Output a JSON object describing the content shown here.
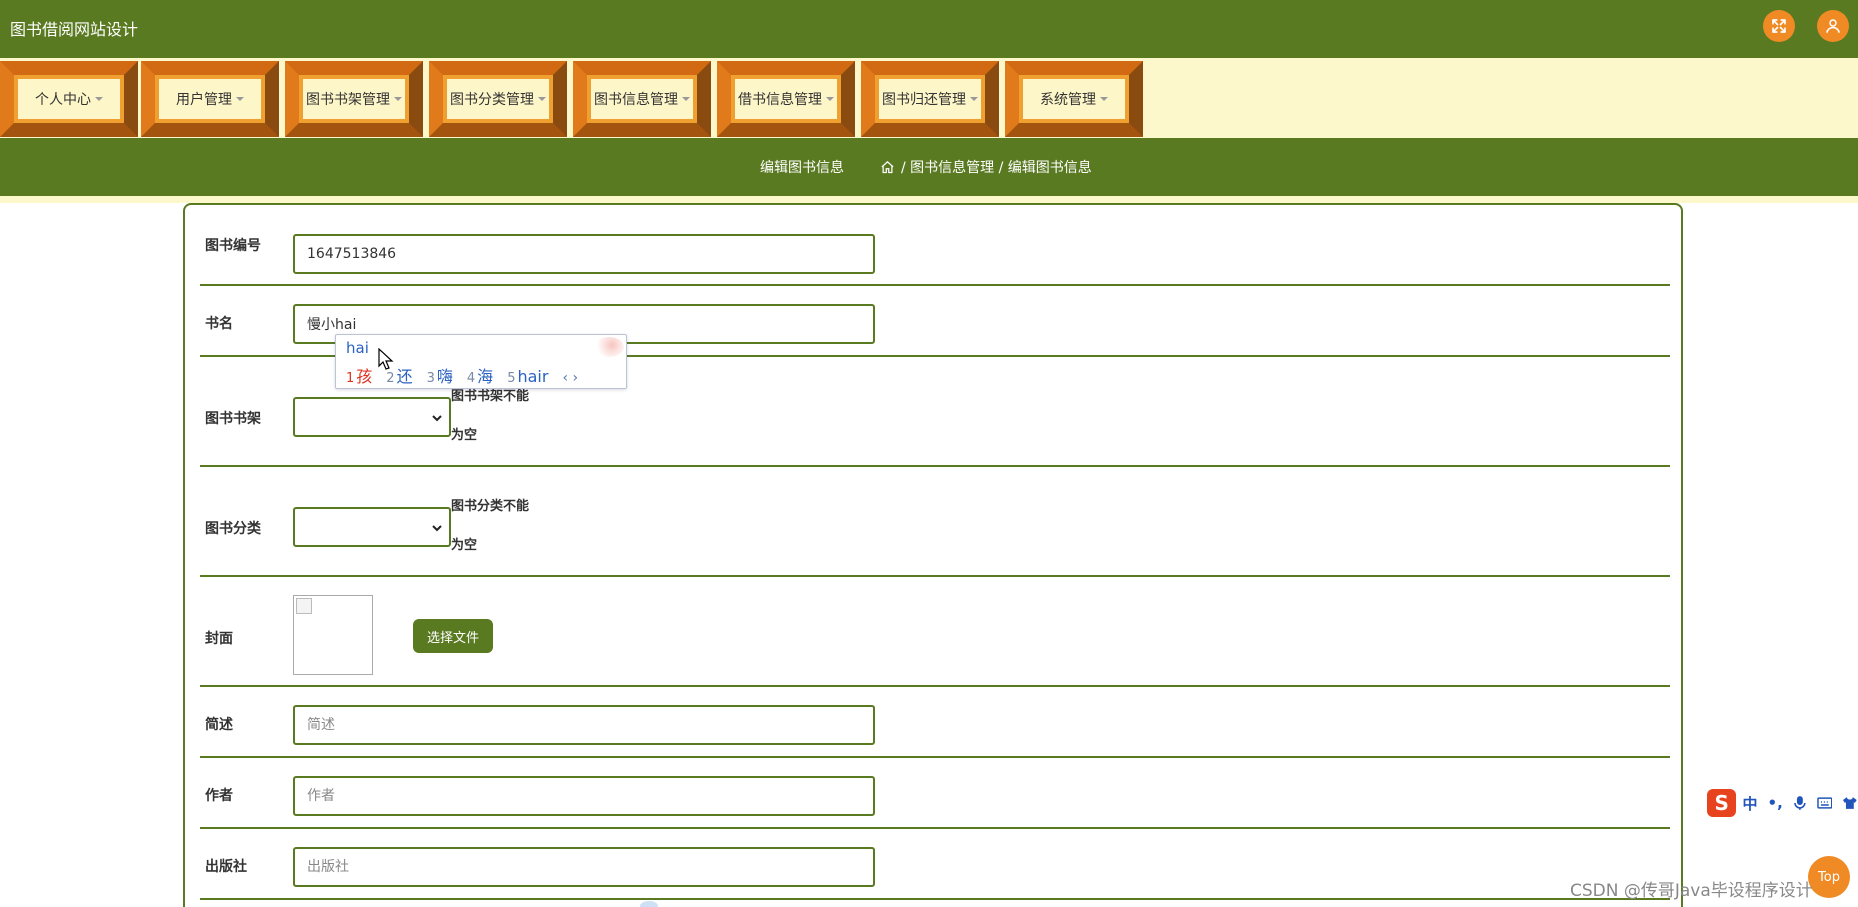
{
  "header": {
    "site_title": "图书借阅网站设计",
    "fullscreen_icon": "expand-icon",
    "user_icon": "user-icon"
  },
  "nav": {
    "items": [
      {
        "label": "个人中心"
      },
      {
        "label": "用户管理"
      },
      {
        "label": "图书书架管理"
      },
      {
        "label": "图书分类管理"
      },
      {
        "label": "图书信息管理"
      },
      {
        "label": "借书信息管理"
      },
      {
        "label": "图书归还管理"
      },
      {
        "label": "系统管理"
      }
    ]
  },
  "breadcrumb": {
    "page_title": "编辑图书信息",
    "home_icon": "home-icon",
    "path": "/ 图书信息管理 / 编辑图书信息"
  },
  "form": {
    "book_no": {
      "label": "图书编号",
      "value": "1647513846"
    },
    "book_name": {
      "label": "书名",
      "value": "慢小hai"
    },
    "shelf": {
      "label": "图书书架",
      "hint": "图书书架不能为空"
    },
    "category": {
      "label": "图书分类",
      "hint": "图书分类不能为空"
    },
    "cover": {
      "label": "封面",
      "button": "选择文件"
    },
    "summary": {
      "label": "简述",
      "placeholder": "简述"
    },
    "author": {
      "label": "作者",
      "placeholder": "作者"
    },
    "publisher": {
      "label": "出版社",
      "placeholder": "出版社"
    }
  },
  "ime": {
    "composition": "hai",
    "candidates": [
      {
        "n": "1",
        "text": "孩"
      },
      {
        "n": "2",
        "text": "还"
      },
      {
        "n": "3",
        "text": "嗨"
      },
      {
        "n": "4",
        "text": "海"
      },
      {
        "n": "5",
        "text": "hair"
      }
    ],
    "arrows": "‹ ›"
  },
  "sogou": {
    "logo": "S",
    "mode": "中",
    "punct": "•,",
    "icons": [
      "mic-icon",
      "keyboard-icon",
      "skin-icon"
    ]
  },
  "top_button": "Top",
  "watermark": "CSDN @传哥Java毕设程序设计",
  "colors": {
    "primary_green": "#5a7a22",
    "accent_orange": "#f08a24",
    "nav_bg": "#fdf8cc"
  }
}
